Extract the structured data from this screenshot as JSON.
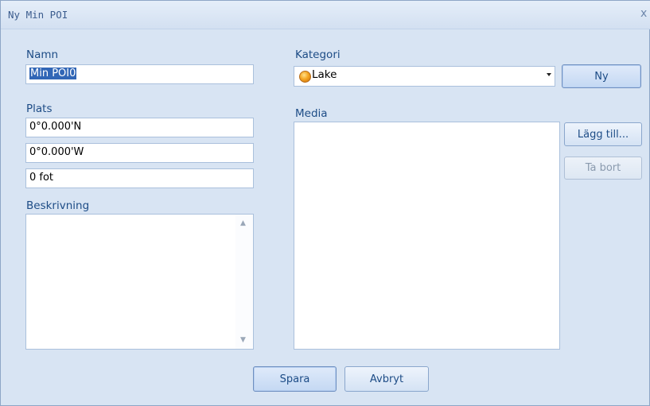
{
  "window": {
    "title": "Ny Min POI",
    "close_symbol": "x"
  },
  "form": {
    "name_label": "Namn",
    "name_value": "Min POI0",
    "category_label": "Kategori",
    "category_value": "Lake",
    "category_icon": "orange-circle-icon",
    "new_category_label": "Ny",
    "location_label": "Plats",
    "latitude_value": "0°0.000'N",
    "longitude_value": "0°0.000'W",
    "altitude_value": "0 fot",
    "media_label": "Media",
    "add_media_label": "Lägg till...",
    "remove_media_label": "Ta bort",
    "description_label": "Beskrivning",
    "description_value": ""
  },
  "footer": {
    "save_label": "Spara",
    "cancel_label": "Avbryt"
  },
  "colors": {
    "dialog_bg": "#d8e4f3",
    "label_text": "#1d4c86",
    "selection": "#3166b6"
  }
}
